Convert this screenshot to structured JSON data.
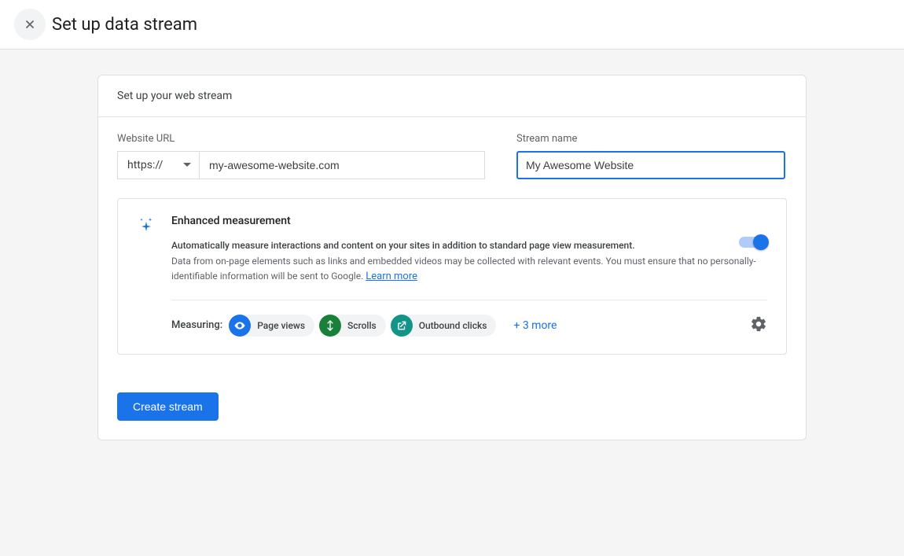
{
  "header": {
    "title": "Set up data stream"
  },
  "card": {
    "section_label": "Set up your web stream",
    "website_url_label": "Website URL",
    "protocol": "https://",
    "url_value": "my-awesome-website.com",
    "stream_name_label": "Stream name",
    "stream_name_value": "My Awesome Website"
  },
  "enhanced": {
    "title": "Enhanced measurement",
    "subtitle": "Automatically measure interactions and content on your sites in addition to standard page view measurement.",
    "description": "Data from on-page elements such as links and embedded videos may be collected with relevant events. You must ensure that no personally-identifiable information will be sent to Google. ",
    "learn_more": "Learn more",
    "measuring_label": "Measuring:",
    "chips": {
      "page_views": "Page views",
      "scrolls": "Scrolls",
      "outbound": "Outbound clicks"
    },
    "more": "+ 3 more"
  },
  "actions": {
    "create": "Create stream"
  }
}
